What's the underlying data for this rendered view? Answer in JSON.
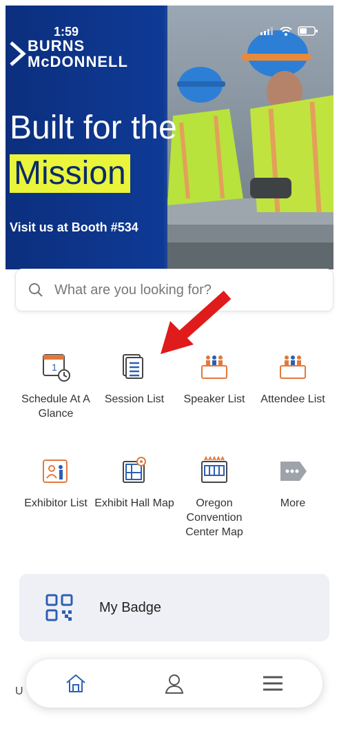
{
  "status": {
    "time": "1:59"
  },
  "banner": {
    "logo_line1": "BURNS",
    "logo_line2": "McDONNELL",
    "headline_line1": "Built for the",
    "headline_line2": "Mission",
    "booth": "Visit us at Booth #534"
  },
  "search": {
    "placeholder": "What are you looking for?"
  },
  "grid": [
    {
      "label": "Schedule At A Glance",
      "icon": "calendar-clock-icon"
    },
    {
      "label": "Session List",
      "icon": "session-list-icon"
    },
    {
      "label": "Speaker List",
      "icon": "speaker-group-icon"
    },
    {
      "label": "Attendee List",
      "icon": "attendee-group-icon"
    },
    {
      "label": "Exhibitor List",
      "icon": "exhibitor-icon"
    },
    {
      "label": "Exhibit Hall Map",
      "icon": "hall-map-icon"
    },
    {
      "label": "Oregon Convention Center Map",
      "icon": "convention-center-icon"
    },
    {
      "label": "More",
      "icon": "more-tag-icon"
    }
  ],
  "badge": {
    "label": "My Badge"
  },
  "bottom_nav": {
    "items": [
      "home-icon",
      "profile-icon",
      "menu-icon"
    ],
    "under_text": "U"
  },
  "colors": {
    "accent_orange": "#e07a3c",
    "accent_blue": "#2b5fb5",
    "highlight_yellow": "#e9f43a",
    "arrow_red": "#e01b1b"
  }
}
